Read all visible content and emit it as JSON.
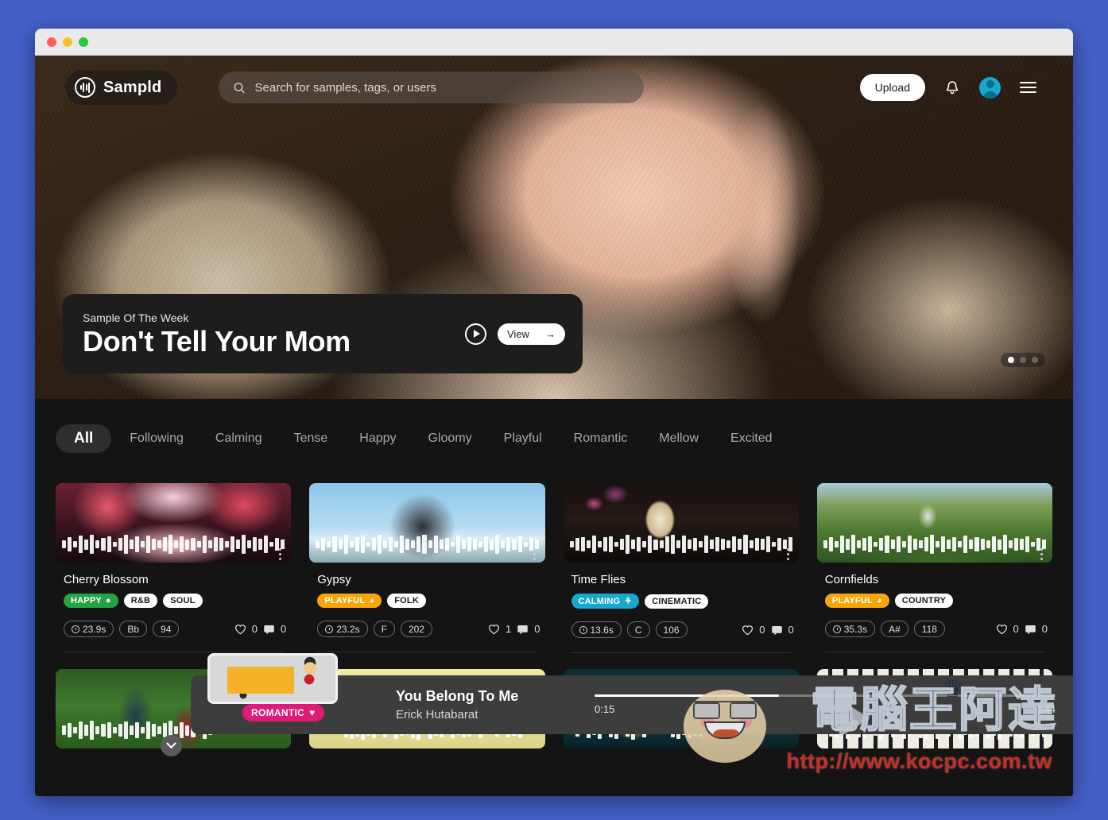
{
  "window": {
    "traffic_lights": [
      "close",
      "minimize",
      "maximize"
    ]
  },
  "header": {
    "logo_text": "Sampld",
    "logo_icon": "waveform-circle-icon",
    "search": {
      "placeholder": "Search for samples, tags, or users",
      "value": "",
      "icon": "search-icon"
    },
    "upload_label": "Upload",
    "notifications_icon": "bell-icon",
    "avatar_icon": "user-avatar",
    "menu_icon": "hamburger-menu-icon"
  },
  "hero": {
    "kicker": "Sample Of The Week",
    "title": "Don't Tell Your Mom",
    "play_icon": "play-circle-icon",
    "view_label": "View",
    "view_arrow": "→",
    "carousel": {
      "count": 3,
      "active_index": 0
    }
  },
  "filters": {
    "items": [
      {
        "label": "All",
        "active": true
      },
      {
        "label": "Following",
        "active": false
      },
      {
        "label": "Calming",
        "active": false
      },
      {
        "label": "Tense",
        "active": false
      },
      {
        "label": "Happy",
        "active": false
      },
      {
        "label": "Gloomy",
        "active": false
      },
      {
        "label": "Playful",
        "active": false
      },
      {
        "label": "Romantic",
        "active": false
      },
      {
        "label": "Mellow",
        "active": false
      },
      {
        "label": "Excited",
        "active": false
      }
    ]
  },
  "colors": {
    "mood_happy": "#25a244",
    "mood_playful": "#f6a609",
    "mood_calming": "#16a8cf",
    "mood_romantic": "#e01a76",
    "accent_blue": "#4460c8",
    "page_bg": "#141414",
    "card_bg": "#1d1d1d"
  },
  "cards": [
    {
      "title": "Cherry Blossom",
      "mood": {
        "label": "HAPPY",
        "color": "#25a244",
        "glyph": "●"
      },
      "genres": [
        "R&B",
        "SOUL"
      ],
      "duration": "23.9s",
      "key": "Bb",
      "bpm": "94",
      "likes": "0",
      "comments": "0",
      "thumb": "cherry-blossom-tunnel"
    },
    {
      "title": "Gypsy",
      "mood": {
        "label": "PLAYFUL",
        "color": "#f6a609",
        "glyph": "◕"
      },
      "genres": [
        "FOLK"
      ],
      "duration": "23.2s",
      "key": "F",
      "bpm": "202",
      "likes": "1",
      "comments": "0",
      "thumb": "woman-with-veil-beach"
    },
    {
      "title": "Time Flies",
      "mood": {
        "label": "CALMING",
        "color": "#16a8cf",
        "glyph": "⚘"
      },
      "genres": [
        "CINEMATIC"
      ],
      "duration": "13.6s",
      "key": "C",
      "bpm": "106",
      "likes": "0",
      "comments": "0",
      "thumb": "hourglass-and-flowers"
    },
    {
      "title": "Cornfields",
      "mood": {
        "label": "PLAYFUL",
        "color": "#f6a609",
        "glyph": "◕"
      },
      "genres": [
        "COUNTRY"
      ],
      "duration": "35.3s",
      "key": "A#",
      "bpm": "118",
      "likes": "0",
      "comments": "0",
      "thumb": "farmer-in-cornfield"
    }
  ],
  "cards_row2": [
    {
      "thumb": "couple-holding-hands-garden"
    },
    {
      "thumb": "sunglasses-yellow-background"
    },
    {
      "thumb": "dark-teal-splash"
    },
    {
      "thumb": "piano-keys"
    }
  ],
  "player": {
    "badge": {
      "label": "ROMANTIC",
      "glyph": "♥",
      "color": "#e01a76"
    },
    "track": "You Belong To Me",
    "artist": "Erick Hutabarat",
    "time_current": "0:15",
    "time_total": "0:44",
    "progress_percent": 40,
    "thumb": "yellow-lego-car",
    "collapse_icon": "chevron-down-icon",
    "play_icon": "play-icon"
  },
  "watermark": {
    "brand": "電腦王阿達",
    "url": "http://www.kocpc.com.tw",
    "crown_glyph": "♛"
  }
}
